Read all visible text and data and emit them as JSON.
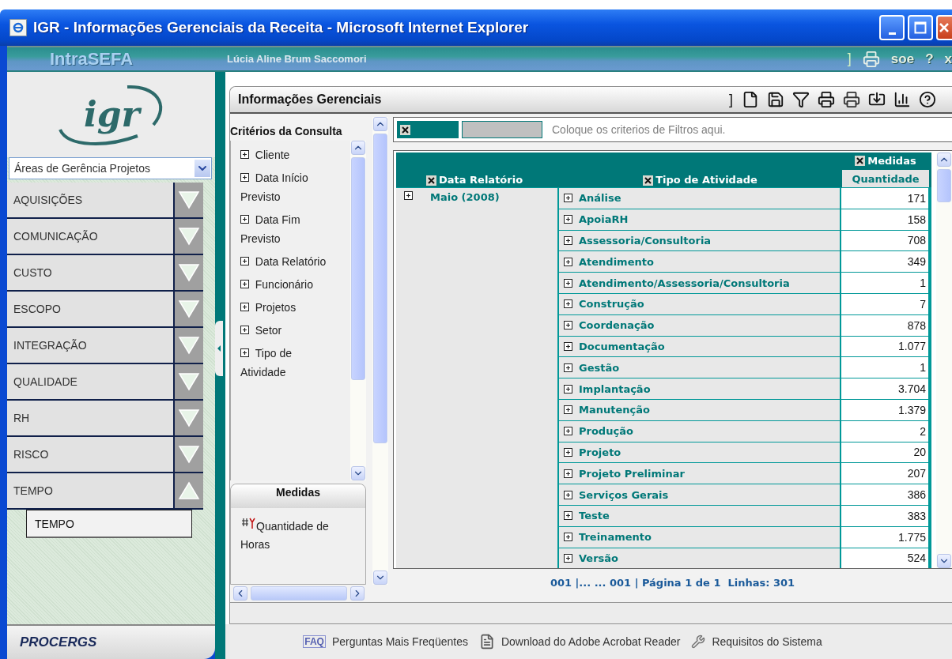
{
  "window": {
    "title": "IGR - Informações Gerenciais da Receita - Microsoft Internet Explorer"
  },
  "header": {
    "brand": "IntraSEFA",
    "user": "Lúcia Aline Brum Saccomori",
    "marker": "]",
    "actions": [
      "soe",
      "?",
      "x"
    ]
  },
  "sidebar": {
    "logo": "igr",
    "area_select": "Áreas de Gerência Projetos",
    "sections": [
      {
        "label": "AQUISIÇÕES",
        "expanded": false
      },
      {
        "label": "COMUNICAÇÃO",
        "expanded": false
      },
      {
        "label": "CUSTO",
        "expanded": false
      },
      {
        "label": "ESCOPO",
        "expanded": false
      },
      {
        "label": "INTEGRAÇÃO",
        "expanded": false
      },
      {
        "label": "QUALIDADE",
        "expanded": false
      },
      {
        "label": "RH",
        "expanded": false
      },
      {
        "label": "RISCO",
        "expanded": false
      },
      {
        "label": "TEMPO",
        "expanded": true,
        "children": [
          {
            "label": "TEMPO"
          }
        ]
      }
    ]
  },
  "panel": {
    "title": "Informações Gerenciais",
    "marker": "]"
  },
  "criteria": {
    "title": "Critérios da Consulta",
    "items": [
      "Cliente",
      "Data Início Previsto",
      "Data Fim Previsto",
      "Data Relatório",
      "Funcionário",
      "Projetos",
      "Setor",
      "Tipo de Atividade"
    ]
  },
  "measures": {
    "title": "Medidas",
    "items": [
      "Quantidade de Horas"
    ]
  },
  "filter": {
    "placeholder": "Coloque os criterios de Filtros aqui."
  },
  "table": {
    "row_header": "Data Relatório",
    "column_header": "Tipo de Atividade",
    "measures_header": "Medidas",
    "measure": "Quantidade",
    "groups": [
      {
        "label": "Maio (2008)",
        "rows": [
          {
            "label": "Análise",
            "value": "171"
          },
          {
            "label": "ApoiaRH",
            "value": "158"
          },
          {
            "label": "Assessoria/Consultoria",
            "value": "708"
          },
          {
            "label": "Atendimento",
            "value": "349"
          },
          {
            "label": "Atendimento/Assessoria/Consultoria",
            "value": "1"
          },
          {
            "label": "Construção",
            "value": "7"
          },
          {
            "label": "Coordenação",
            "value": "878"
          },
          {
            "label": "Documentação",
            "value": "1.077"
          },
          {
            "label": "Gestão",
            "value": "1"
          },
          {
            "label": "Implantação",
            "value": "3.704"
          },
          {
            "label": "Manutenção",
            "value": "1.379"
          },
          {
            "label": "Produção",
            "value": "2"
          },
          {
            "label": "Projeto",
            "value": "20"
          },
          {
            "label": "Projeto Preliminar",
            "value": "207"
          },
          {
            "label": "Serviços Gerais",
            "value": "386"
          },
          {
            "label": "Teste",
            "value": "383"
          },
          {
            "label": "Treinamento",
            "value": "1.775"
          },
          {
            "label": "Versão",
            "value": "524"
          }
        ]
      }
    ]
  },
  "pager": "001 |... ... 001 | Página 1 de 1  Linhas: 301",
  "vendor": "PROCERGS",
  "footer": {
    "links": [
      {
        "kind": "faq",
        "icon_text": "FAQ",
        "label": "Perguntas Mais Freqüentes"
      },
      {
        "kind": "pdf",
        "label": "Download do Adobe Acrobat Reader"
      },
      {
        "kind": "tools",
        "label": "Requisitos do Sistema"
      }
    ]
  }
}
